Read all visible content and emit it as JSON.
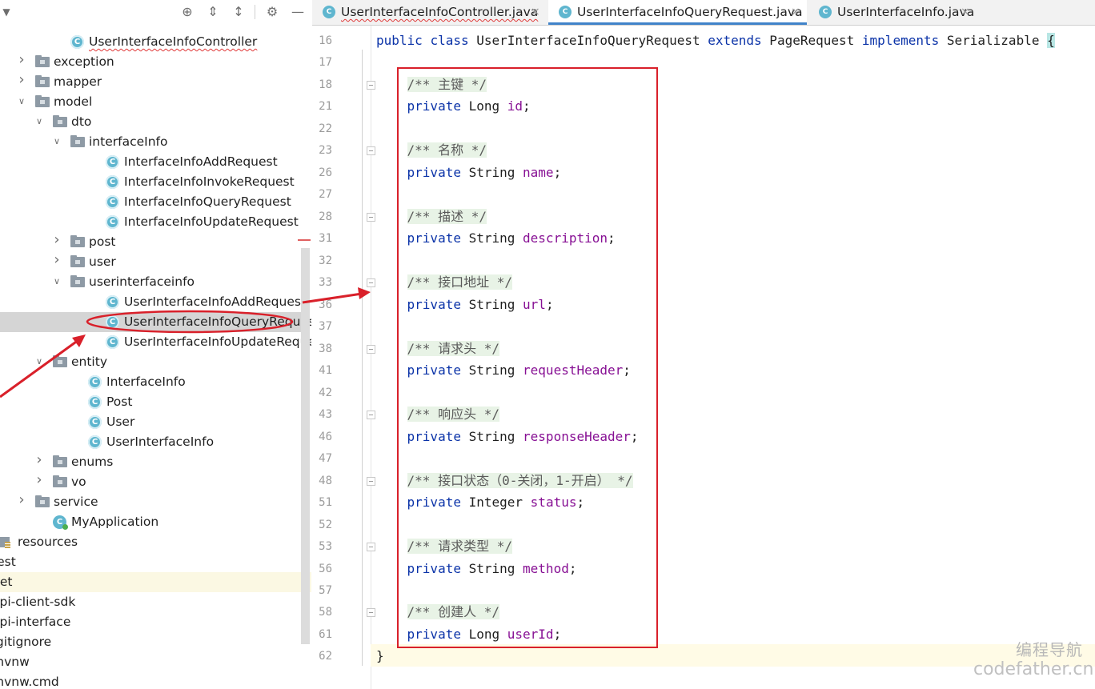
{
  "left_panel": {
    "toolbar": {
      "icons": [
        "locate-icon",
        "expand-all-icon",
        "collapse-all-icon",
        "settings-icon",
        "hide-icon"
      ]
    },
    "tree": [
      {
        "label": "UserInterfaceInfoController",
        "type": "class",
        "indent": 3,
        "underline": true
      },
      {
        "label": "exception",
        "type": "folder",
        "indent": 1,
        "arrow": "collapsed"
      },
      {
        "label": "mapper",
        "type": "folder",
        "indent": 1,
        "arrow": "collapsed"
      },
      {
        "label": "model",
        "type": "folder",
        "indent": 1,
        "arrow": "expanded"
      },
      {
        "label": "dto",
        "type": "folder",
        "indent": 2,
        "arrow": "expanded"
      },
      {
        "label": "interfaceInfo",
        "type": "folder",
        "indent": 3,
        "arrow": "expanded"
      },
      {
        "label": "InterfaceInfoAddRequest",
        "type": "class",
        "indent": 5
      },
      {
        "label": "InterfaceInfoInvokeRequest",
        "type": "class",
        "indent": 5
      },
      {
        "label": "InterfaceInfoQueryRequest",
        "type": "class",
        "indent": 5
      },
      {
        "label": "InterfaceInfoUpdateRequest",
        "type": "class",
        "indent": 5
      },
      {
        "label": "post",
        "type": "folder",
        "indent": 3,
        "arrow": "collapsed"
      },
      {
        "label": "user",
        "type": "folder",
        "indent": 3,
        "arrow": "collapsed"
      },
      {
        "label": "userinterfaceinfo",
        "type": "folder",
        "indent": 3,
        "arrow": "expanded"
      },
      {
        "label": "UserInterfaceInfoAddRequest",
        "type": "class",
        "indent": 5
      },
      {
        "label": "UserInterfaceInfoQueryRequest",
        "type": "class",
        "indent": 5,
        "selected": true
      },
      {
        "label": "UserInterfaceInfoUpdateRequest",
        "type": "class",
        "indent": 5
      },
      {
        "label": "entity",
        "type": "folder",
        "indent": 2,
        "arrow": "expanded"
      },
      {
        "label": "InterfaceInfo",
        "type": "class",
        "indent": 4
      },
      {
        "label": "Post",
        "type": "class",
        "indent": 4
      },
      {
        "label": "User",
        "type": "class",
        "indent": 4
      },
      {
        "label": "UserInterfaceInfo",
        "type": "class",
        "indent": 4
      },
      {
        "label": "enums",
        "type": "folder",
        "indent": 2,
        "arrow": "collapsed"
      },
      {
        "label": "vo",
        "type": "folder",
        "indent": 2,
        "arrow": "collapsed"
      },
      {
        "label": "service",
        "type": "folder",
        "indent": 1,
        "arrow": "collapsed"
      },
      {
        "label": "MyApplication",
        "type": "app",
        "indent": 2
      },
      {
        "label": "resources",
        "type": "resources",
        "indent": 0
      },
      {
        "label": "test",
        "type": "text",
        "indent": -1
      },
      {
        "label": "get",
        "type": "text",
        "indent": -1,
        "highlight": true
      },
      {
        "label": "api-client-sdk",
        "type": "text",
        "indent": -1
      },
      {
        "label": "api-interface",
        "type": "text",
        "indent": -1
      },
      {
        "label": ".gitignore",
        "type": "text",
        "indent": -1
      },
      {
        "label": "mvnw",
        "type": "text",
        "indent": -1
      },
      {
        "label": "mvnw.cmd",
        "type": "text",
        "indent": -1
      }
    ]
  },
  "editor": {
    "tabs": [
      {
        "label": "UserInterfaceInfoController.java",
        "active": false,
        "error": true
      },
      {
        "label": "UserInterfaceInfoQueryRequest.java",
        "active": true,
        "error": false
      },
      {
        "label": "UserInterfaceInfo.java",
        "active": false,
        "error": false
      }
    ],
    "close_glyph": "×",
    "lines": [
      {
        "num": "16",
        "tokens": [
          [
            "kw",
            "public"
          ],
          [
            "t",
            " "
          ],
          [
            "kw",
            "class"
          ],
          [
            "t",
            " UserInterfaceInfoQueryRequest "
          ],
          [
            "kw",
            "extends"
          ],
          [
            "t",
            " PageRequest "
          ],
          [
            "kw",
            "implements"
          ],
          [
            "t",
            " Serializable "
          ],
          [
            "brace",
            "{"
          ]
        ]
      },
      {
        "num": "17",
        "tokens": []
      },
      {
        "num": "18",
        "fold": true,
        "tokens": [
          [
            "t",
            "    "
          ],
          [
            "cmt",
            "/** 主键 */"
          ]
        ]
      },
      {
        "num": "21",
        "tokens": [
          [
            "t",
            "    "
          ],
          [
            "kw",
            "private"
          ],
          [
            "t",
            " Long "
          ],
          [
            "fld",
            "id"
          ],
          [
            "t",
            ";"
          ]
        ]
      },
      {
        "num": "22",
        "tokens": []
      },
      {
        "num": "23",
        "fold": true,
        "tokens": [
          [
            "t",
            "    "
          ],
          [
            "cmt",
            "/** 名称 */"
          ]
        ]
      },
      {
        "num": "26",
        "tokens": [
          [
            "t",
            "    "
          ],
          [
            "kw",
            "private"
          ],
          [
            "t",
            " String "
          ],
          [
            "fld",
            "name"
          ],
          [
            "t",
            ";"
          ]
        ]
      },
      {
        "num": "27",
        "tokens": []
      },
      {
        "num": "28",
        "fold": true,
        "tokens": [
          [
            "t",
            "    "
          ],
          [
            "cmt",
            "/** 描述 */"
          ]
        ]
      },
      {
        "num": "31",
        "tokens": [
          [
            "t",
            "    "
          ],
          [
            "kw",
            "private"
          ],
          [
            "t",
            " String "
          ],
          [
            "fld",
            "description"
          ],
          [
            "t",
            ";"
          ]
        ]
      },
      {
        "num": "32",
        "tokens": []
      },
      {
        "num": "33",
        "fold": true,
        "tokens": [
          [
            "t",
            "    "
          ],
          [
            "cmt",
            "/** 接口地址 */"
          ]
        ]
      },
      {
        "num": "36",
        "tokens": [
          [
            "t",
            "    "
          ],
          [
            "kw",
            "private"
          ],
          [
            "t",
            " String "
          ],
          [
            "fld",
            "url"
          ],
          [
            "t",
            ";"
          ]
        ]
      },
      {
        "num": "37",
        "tokens": []
      },
      {
        "num": "38",
        "fold": true,
        "tokens": [
          [
            "t",
            "    "
          ],
          [
            "cmt",
            "/** 请求头 */"
          ]
        ]
      },
      {
        "num": "41",
        "tokens": [
          [
            "t",
            "    "
          ],
          [
            "kw",
            "private"
          ],
          [
            "t",
            " String "
          ],
          [
            "fld",
            "requestHeader"
          ],
          [
            "t",
            ";"
          ]
        ]
      },
      {
        "num": "42",
        "tokens": []
      },
      {
        "num": "43",
        "fold": true,
        "tokens": [
          [
            "t",
            "    "
          ],
          [
            "cmt",
            "/** 响应头 */"
          ]
        ]
      },
      {
        "num": "46",
        "tokens": [
          [
            "t",
            "    "
          ],
          [
            "kw",
            "private"
          ],
          [
            "t",
            " String "
          ],
          [
            "fld",
            "responseHeader"
          ],
          [
            "t",
            ";"
          ]
        ]
      },
      {
        "num": "47",
        "tokens": []
      },
      {
        "num": "48",
        "fold": true,
        "tokens": [
          [
            "t",
            "    "
          ],
          [
            "cmt",
            "/** 接口状态（0-关闭，1-开启） */"
          ]
        ]
      },
      {
        "num": "51",
        "tokens": [
          [
            "t",
            "    "
          ],
          [
            "kw",
            "private"
          ],
          [
            "t",
            " Integer "
          ],
          [
            "fld",
            "status"
          ],
          [
            "t",
            ";"
          ]
        ]
      },
      {
        "num": "52",
        "tokens": []
      },
      {
        "num": "53",
        "fold": true,
        "tokens": [
          [
            "t",
            "    "
          ],
          [
            "cmt",
            "/** 请求类型 */"
          ]
        ]
      },
      {
        "num": "56",
        "tokens": [
          [
            "t",
            "    "
          ],
          [
            "kw",
            "private"
          ],
          [
            "t",
            " String "
          ],
          [
            "fld",
            "method"
          ],
          [
            "t",
            ";"
          ]
        ]
      },
      {
        "num": "57",
        "tokens": []
      },
      {
        "num": "58",
        "fold": true,
        "tokens": [
          [
            "t",
            "    "
          ],
          [
            "cmt",
            "/** 创建人 */"
          ]
        ]
      },
      {
        "num": "61",
        "tokens": [
          [
            "t",
            "    "
          ],
          [
            "kw",
            "private"
          ],
          [
            "t",
            " Long "
          ],
          [
            "fld",
            "userId"
          ],
          [
            "t",
            ";"
          ]
        ]
      },
      {
        "num": "62",
        "tokens": [
          [
            "t",
            "}"
          ]
        ]
      }
    ]
  },
  "watermark": {
    "line1": "编程导航",
    "line2": "codefather.cn"
  },
  "colors": {
    "annotation_red": "#d9202a",
    "keyword": "#0b33a8",
    "field": "#871094",
    "class_icon": "#5fb6cf"
  }
}
